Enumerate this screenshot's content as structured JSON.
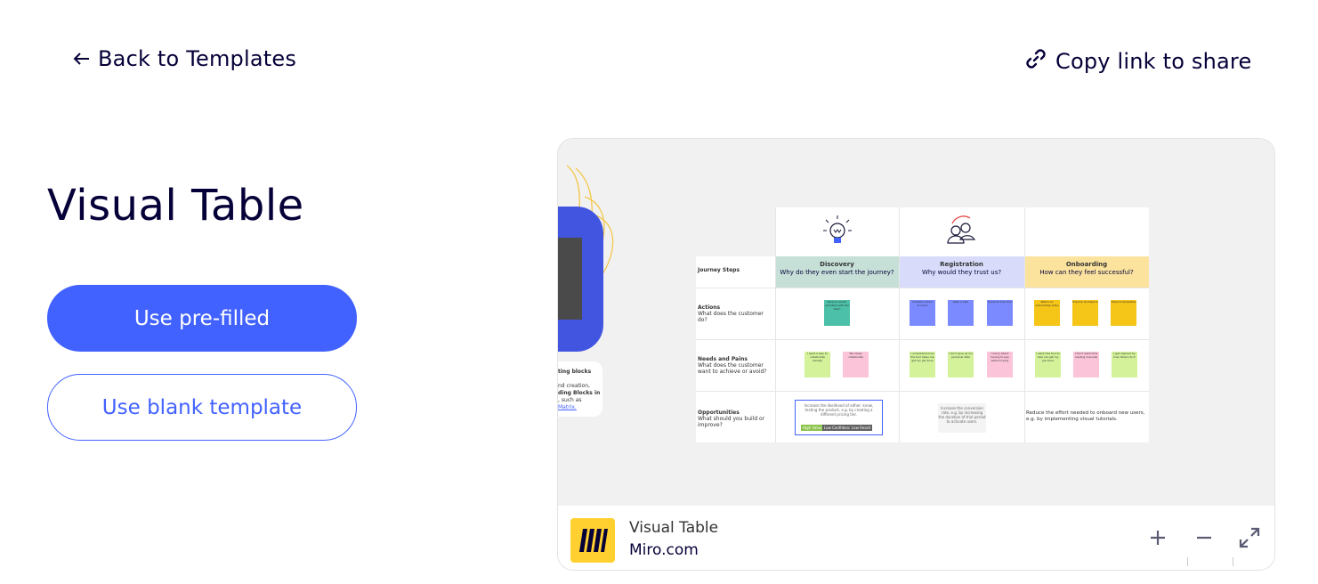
{
  "nav": {
    "back_label": "Back to Templates",
    "copy_label": "Copy link to share"
  },
  "title": "Visual Table",
  "buttons": {
    "prefilled": "Use pre-filled",
    "blank": "Use blank template"
  },
  "preview": {
    "board_name": "Visual Table",
    "site": "Miro.com",
    "controls": [
      "zoom-in",
      "zoom-out",
      "fullscreen"
    ],
    "side_card_lines": [
      "ting blocks",
      "nd creation,",
      "ding Blocks in",
      "  , such as",
      "Matrix."
    ],
    "table": {
      "rows": [
        {
          "title": "Journey Steps",
          "subtitle": ""
        },
        {
          "title": "Actions",
          "subtitle": "What does the customer do?"
        },
        {
          "title": "Needs and Pains",
          "subtitle": "What does the customer want to achieve or avoid?"
        },
        {
          "title": "Opportunities",
          "subtitle": "What should you build or improve?"
        }
      ],
      "columns": [
        {
          "title": "Discovery",
          "subtitle": "Why do they even start the journey?",
          "color": "#c6e0d8"
        },
        {
          "title": "Registration",
          "subtitle": "Why would they trust us?",
          "color": "#d8dcfa"
        },
        {
          "title": "Onboarding",
          "subtitle": "How can they feel successful?",
          "color": "#fbe39e"
        }
      ],
      "notes": {
        "discovery_action": "Runs an event remotely with the team",
        "registration_actions": [
          "Creates a team account",
          "Tests a plan",
          "Explores free trial"
        ],
        "onboarding_actions": [
          "Watch an onboarding video",
          "Explore workspace",
          "Explore templates"
        ],
        "discovery_needs": [
          "I want a way to collaborate visually",
          "We rarely collaborate"
        ],
        "registration_needs": [
          "I understand how the tool helps me get my job done",
          "I don't give up my personal data",
          "I worry about having to pay before trying"
        ],
        "onboarding_needs": [
          "I want this tool to help me get my job done",
          "I don't want time reading manuals",
          "I get inspired by how others do it"
        ],
        "discovery_opportunity": "Increase the likelihood of either: know, testing the product, e.g. by creating a different pricing tier.",
        "discovery_tags": [
          "High Value",
          "Low Confidence",
          "Low Reach"
        ],
        "registration_opportunity": "Increase the conversion rate, e.g. by increasing the duration of trial period to activate users.",
        "onboarding_opportunity": "Reduce the effort needed to onboard new users, e.g. by implementing visual tutorials."
      }
    }
  },
  "colors": {
    "primary": "#4262ff",
    "ink": "#050038",
    "miro_yellow": "#ffd02f",
    "note_teal": "#4cc0a8",
    "note_blue": "#7b8bff",
    "note_yellow": "#f5c518",
    "note_green": "#d3f29a",
    "note_pink": "#fbc4d8"
  }
}
